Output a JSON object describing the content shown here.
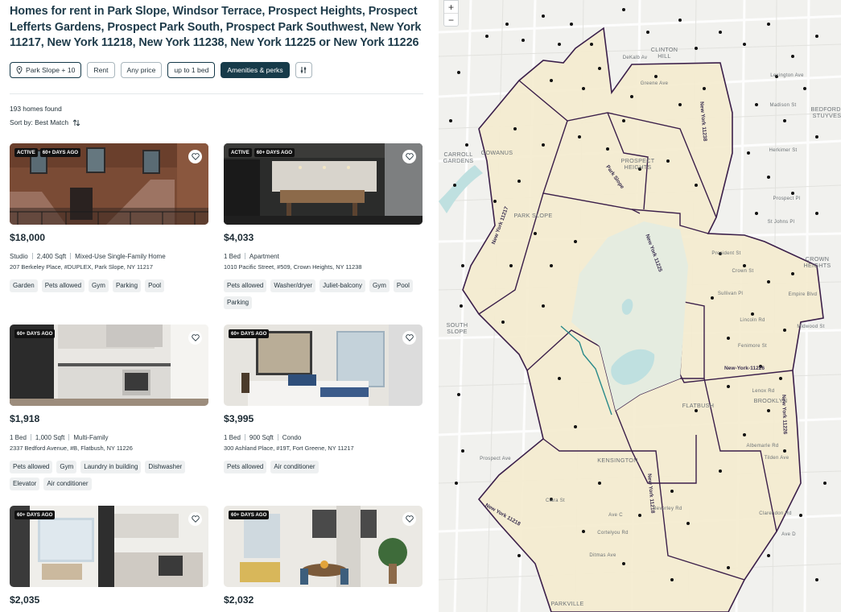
{
  "page": {
    "title": "Homes for rent in Park Slope, Windsor Terrace, Prospect Heights, Prospect Lefferts Gardens, Prospect Park South, Prospect Park Southwest, New York 11217, New York 11218, New York 11238, New York 11225 or New York 11226",
    "homes_found": "193 homes found",
    "sort_label": "Sort by: Best Match"
  },
  "filters": {
    "location": "Park Slope + 10",
    "listing_type": "Rent",
    "price": "Any price",
    "beds": "up to 1 bed",
    "amenities": "Amenities & perks"
  },
  "listings": [
    {
      "badges": [
        "ACTIVE",
        "60+ DAYS AGO"
      ],
      "price": "$18,000",
      "specs": [
        "Studio",
        "2,400 Sqft",
        "Mixed-Use Single-Family Home"
      ],
      "address": "207 Berkeley Place, #DUPLEX, Park Slope, NY 11217",
      "amenities": [
        "Garden",
        "Pets allowed",
        "Gym",
        "Parking",
        "Pool"
      ]
    },
    {
      "badges": [
        "ACTIVE",
        "60+ DAYS AGO"
      ],
      "price": "$4,033",
      "specs": [
        "1 Bed",
        "Apartment"
      ],
      "address": "1010 Pacific Street, #509, Crown Heights, NY 11238",
      "amenities": [
        "Pets allowed",
        "Washer/dryer",
        "Juliet-balcony",
        "Gym",
        "Pool",
        "Parking"
      ]
    },
    {
      "badges": [
        "60+ DAYS AGO"
      ],
      "price": "$1,918",
      "specs": [
        "1 Bed",
        "1,000 Sqft",
        "Multi-Family"
      ],
      "address": "2337 Bedford Avenue, #B, Flatbush, NY 11226",
      "amenities": [
        "Pets allowed",
        "Gym",
        "Laundry in building",
        "Dishwasher",
        "Elevator",
        "Air conditioner"
      ]
    },
    {
      "badges": [
        "60+ DAYS AGO"
      ],
      "price": "$3,995",
      "specs": [
        "1 Bed",
        "900 Sqft",
        "Condo"
      ],
      "address": "300 Ashland Place, #19T, Fort Greene, NY 11217",
      "amenities": [
        "Pets allowed",
        "Air conditioner"
      ]
    },
    {
      "badges": [
        "60+ DAYS AGO"
      ],
      "price": "$2,035",
      "specs": [],
      "address": "",
      "amenities": []
    },
    {
      "badges": [
        "60+ DAYS AGO"
      ],
      "price": "$2,032",
      "specs": [],
      "address": "",
      "amenities": []
    }
  ],
  "map": {
    "zoom_in": "+",
    "zoom_out": "−",
    "neighborhoods": [
      "CLINTON HILL",
      "BEDFORD-STUYVES",
      "CARROLL GARDENS",
      "GOWANUS",
      "PROSPECT HEIGHTS",
      "PARK SLOPE",
      "CROWN HEIGHTS",
      "SOUTH SLOPE",
      "FLATBUSH",
      "BROOKLYN",
      "KENSINGTON",
      "PARKVILLE"
    ],
    "zip_labels": [
      "New York 11238",
      "New York 11217",
      "New York 11225",
      "New-York-11226",
      "New York 11226",
      "New York 11218",
      "New York 11218"
    ],
    "streets": [
      "DeKalb Av",
      "Greene Ave",
      "Lexington Ave",
      "Madison St",
      "Herkimer St",
      "Prospect Pl",
      "St Johns Pl",
      "President St",
      "Crown St",
      "Sullivan Pl",
      "Empire Blvd",
      "Lincoln Rd",
      "Midwood St",
      "Fenimore St",
      "Lenox Rd",
      "Tilden Ave",
      "Beverley Rd",
      "Clarendon Rd",
      "Cortelyou Rd",
      "Ditmas Ave",
      "Albemarle Rd",
      "Ave C",
      "Ave D",
      "Park Slope",
      "Clara St",
      "Prospect Ave"
    ],
    "colors": {
      "zone_fill": "#f4ebcf",
      "zone_border": "#3b1f4a",
      "water": "#bfe0e0",
      "dot": "#111111"
    }
  }
}
